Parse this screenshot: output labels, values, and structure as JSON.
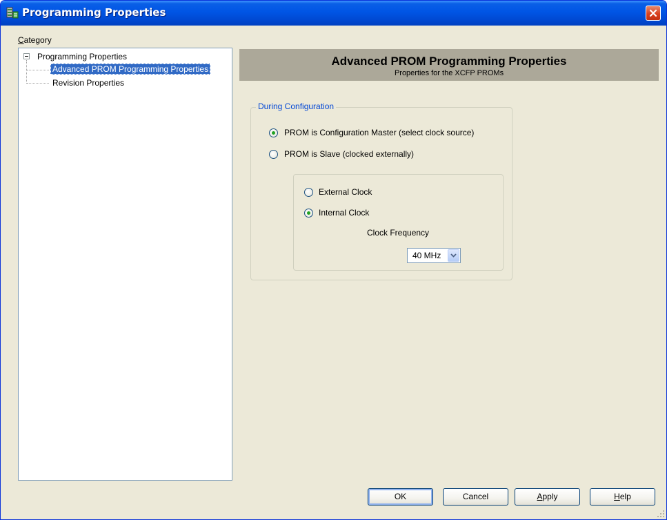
{
  "window": {
    "title": "Programming Properties"
  },
  "category": {
    "label_underlined": "C",
    "label_rest": "ategory"
  },
  "tree": {
    "root": "Programming Properties",
    "children": [
      {
        "label": "Advanced PROM Programming Properties",
        "selected": true
      },
      {
        "label": "Revision Properties",
        "selected": false
      }
    ]
  },
  "panel": {
    "title": "Advanced PROM Programming Properties",
    "subtitle": "Properties for the XCFP PROMs"
  },
  "group": {
    "legend": "During Configuration",
    "options": [
      {
        "label": "PROM is Configuration Master (select clock source)",
        "checked": true
      },
      {
        "label": "PROM is Slave (clocked externally)",
        "checked": false
      }
    ],
    "clock_options": [
      {
        "label": "External Clock",
        "checked": false
      },
      {
        "label": "Internal Clock",
        "checked": true
      }
    ],
    "frequency_label": "Clock Frequency",
    "frequency_value": "40 MHz"
  },
  "buttons": {
    "ok": "OK",
    "cancel": "Cancel",
    "apply_u": "A",
    "apply_rest": "pply",
    "help_u": "H",
    "help_rest": "elp"
  },
  "colors": {
    "selection": "#316ac5",
    "header_band": "#aca899",
    "dialog_bg": "#ece9d8",
    "legend_text": "#0046d5"
  }
}
